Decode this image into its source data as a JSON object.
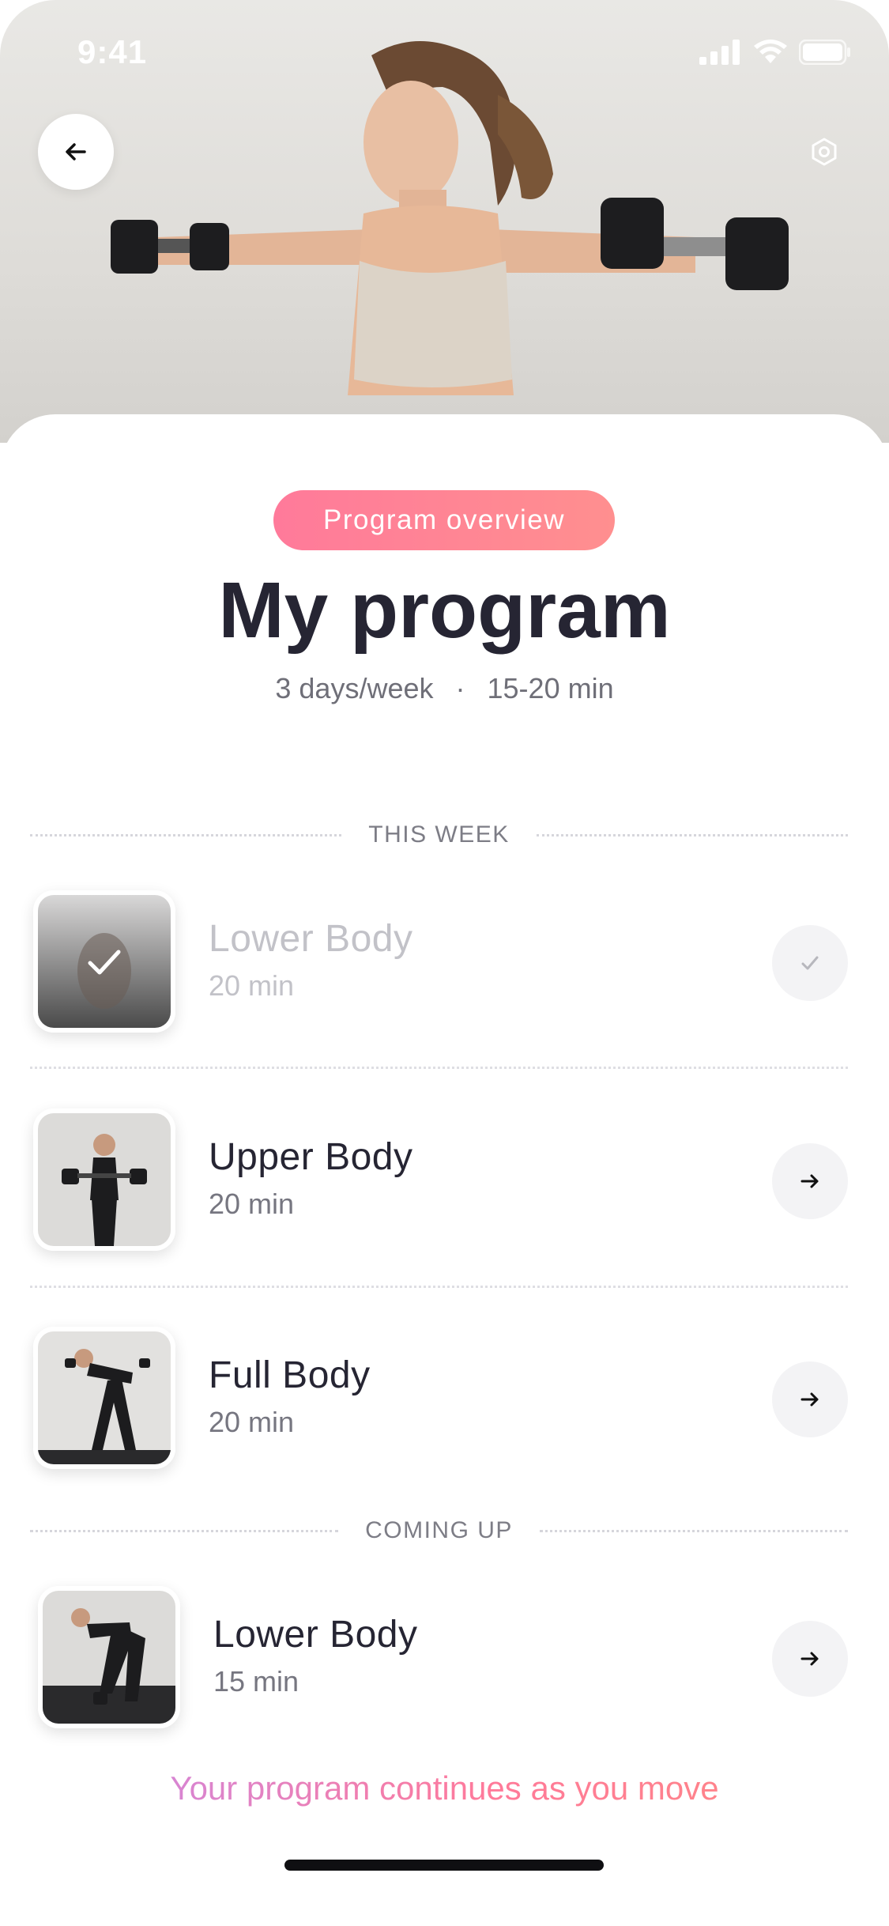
{
  "status_bar": {
    "time": "9:41"
  },
  "header": {
    "back_icon": "arrow-left-icon",
    "settings_icon": "settings-icon"
  },
  "hero": {
    "subject": "woman holding dumbbells"
  },
  "program": {
    "badge": "Program overview",
    "title": "My program",
    "frequency": "3 days/week",
    "separator": "·",
    "duration": "15-20 min"
  },
  "this_week": {
    "label": "THIS WEEK",
    "items": [
      {
        "title": "Lower Body",
        "duration": "20 min",
        "completed": true,
        "action_icon": "check-icon"
      },
      {
        "title": "Upper Body",
        "duration": "20 min",
        "completed": false,
        "action_icon": "arrow-right-icon"
      },
      {
        "title": "Full Body",
        "duration": "20 min",
        "completed": false,
        "action_icon": "arrow-right-icon"
      }
    ]
  },
  "coming_up": {
    "label": "COMING UP",
    "items": [
      {
        "title": "Lower Body",
        "duration": "15 min",
        "action_icon": "arrow-right-icon"
      }
    ]
  },
  "footer": {
    "message": "Your program continues as you move"
  },
  "colors": {
    "accent_pink": "#ff7a9a",
    "accent_purple": "#c38bf0",
    "text_dark": "#262533"
  }
}
